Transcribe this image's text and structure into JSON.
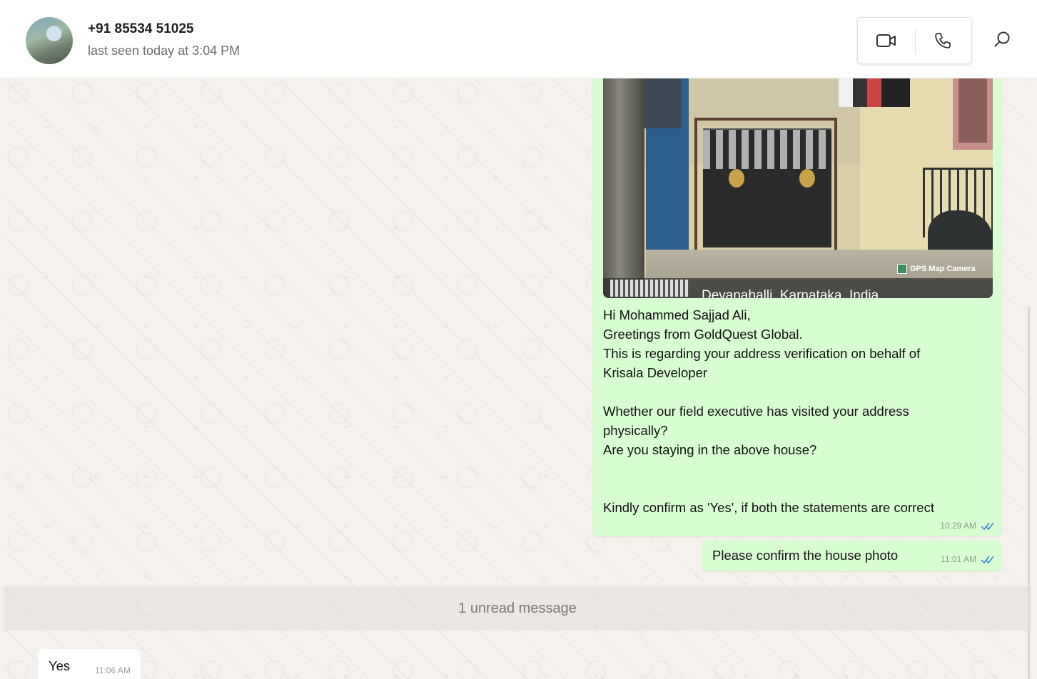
{
  "header": {
    "contact_name": "+91 85534 51025",
    "last_seen": "last seen today at 3:04 PM",
    "icons": [
      "video-call-icon",
      "voice-call-icon",
      "search-icon"
    ]
  },
  "messages": {
    "outgoing_image": {
      "photo_badge": "GPS Map Camera",
      "photo_caption": "Devanahalli, Karnataka, India",
      "lines": [
        "Hi Mohammed Sajjad Ali,",
        "Greetings from GoldQuest Global.",
        "This is regarding your address verification on behalf of",
        "Krisala Developer",
        "",
        "Whether our field executive has visited your address",
        "physically?",
        "Are you staying in the above house?",
        "",
        "",
        "Kindly confirm as 'Yes', if both the statements are correct"
      ],
      "time": "10:29 AM",
      "status_icon": "double-tick-read-icon"
    },
    "outgoing_text": {
      "text": "Please confirm the house photo",
      "time": "11:01 AM",
      "status_icon": "double-tick-read-icon"
    },
    "unread_banner": "1 unread message",
    "incoming_text": {
      "text": "Yes",
      "time": "11:06 AM"
    }
  },
  "colors": {
    "outgoing_bubble": "#d9fdd3",
    "incoming_bubble": "#ffffff",
    "read_tick": "#4a8fd6",
    "chat_background": "#f5f1ed"
  }
}
